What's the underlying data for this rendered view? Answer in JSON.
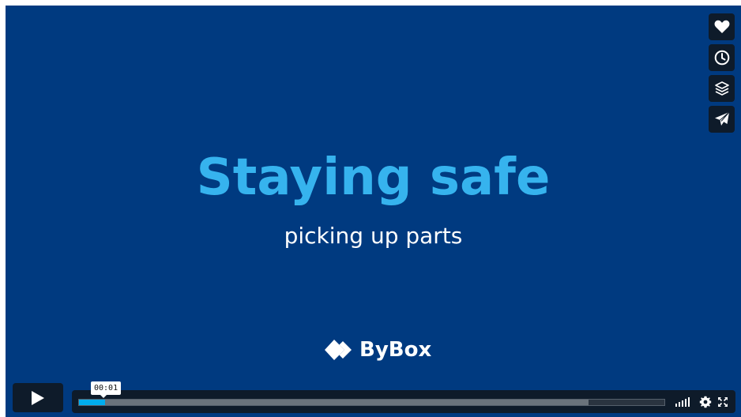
{
  "video": {
    "title": "Staying safe",
    "subtitle": "picking up parts",
    "brand": "ByBox",
    "accent_color": "#36b3ee",
    "background_color": "#003a80"
  },
  "side_actions": [
    {
      "icon": "heart-icon",
      "name": "like"
    },
    {
      "icon": "clock-icon",
      "name": "watch-later"
    },
    {
      "icon": "layers-icon",
      "name": "collections"
    },
    {
      "icon": "paper-plane-icon",
      "name": "share"
    }
  ],
  "controls": {
    "play_icon": "play-icon",
    "current_time": "00:01",
    "progress_played_fraction": 0.045,
    "progress_buffered_fraction": 0.87,
    "volume_icon": "volume-bars-icon",
    "settings_icon": "gear-icon",
    "fullscreen_icon": "fullscreen-icon"
  }
}
